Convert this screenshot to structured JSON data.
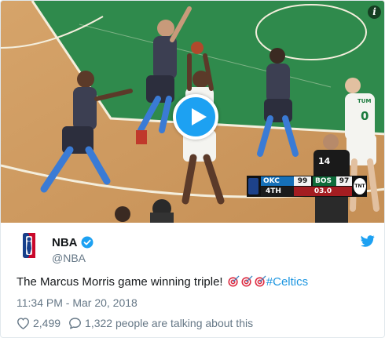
{
  "video": {
    "scoreboard": {
      "away_team": "OKC",
      "away_score": "99",
      "home_team": "BOS",
      "home_score": "97",
      "period": "4TH",
      "clock": "03.0",
      "network": "TNT"
    },
    "referee_number": "14",
    "jersey_name": "TUM",
    "jersey_number": "0",
    "info_icon": "info-icon",
    "play_icon": "play-icon"
  },
  "tweet": {
    "display_name": "NBA",
    "handle": "@NBA",
    "verified": true,
    "text_before": "The Marcus Morris game winning triple! ",
    "emoji": [
      "bullseye",
      "bullseye",
      "bullseye"
    ],
    "hashtag": "#Celtics",
    "timestamp": "11:34 PM - Mar 20, 2018",
    "like_count": "2,499",
    "talking_text": "1,322 people are talking about this"
  },
  "colors": {
    "brand_blue": "#1da1f2",
    "hashtag_blue": "#1b95e0",
    "secondary_text": "#657786"
  }
}
